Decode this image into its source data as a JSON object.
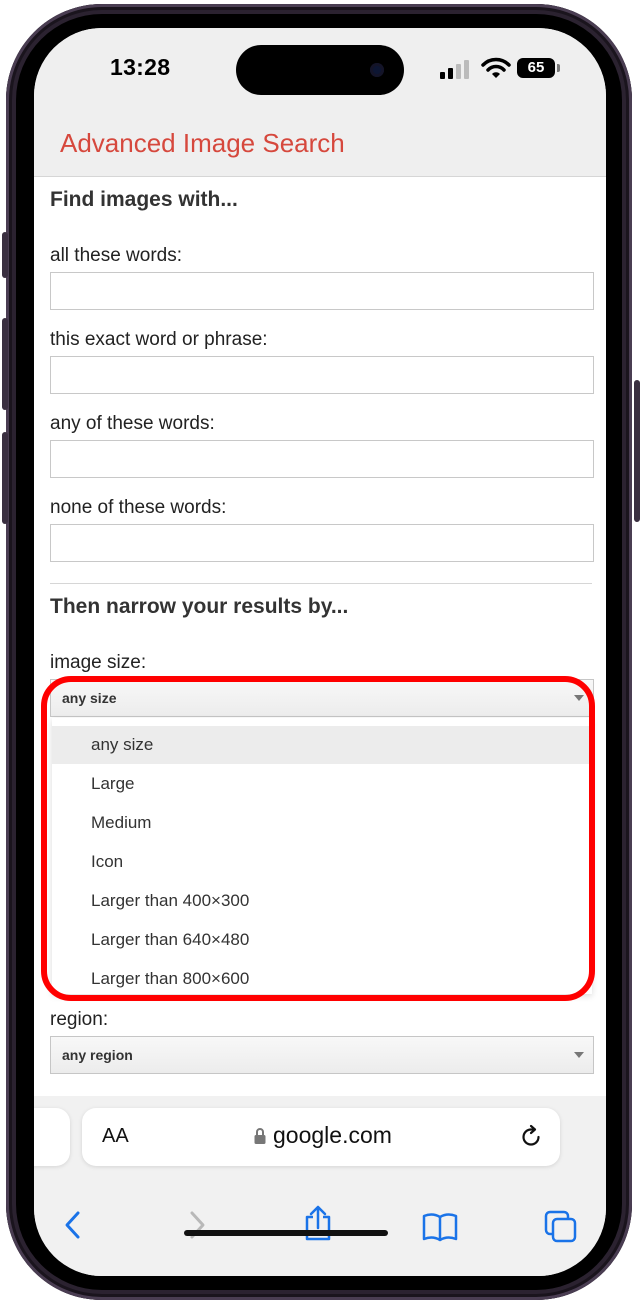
{
  "status_bar": {
    "time": "13:28",
    "battery": "65"
  },
  "page": {
    "title": "Advanced Image Search",
    "section_find": "Find images with...",
    "labels": {
      "all_words": "all these words:",
      "exact_phrase": "this exact word or phrase:",
      "any_words": "any of these words:",
      "none_words": "none of these words:"
    },
    "section_narrow": "Then narrow your results by...",
    "image_size": {
      "label": "image size:",
      "selected": "any size",
      "options": [
        "any size",
        "Large",
        "Medium",
        "Icon",
        "Larger than 400×300",
        "Larger than 640×480",
        "Larger than 800×600"
      ]
    },
    "region": {
      "label": "region:",
      "selected": "any region"
    }
  },
  "safari": {
    "aa_label": "AA",
    "url": "google.com"
  },
  "icons": {
    "back": "chevron-left-icon",
    "forward": "chevron-right-icon",
    "share": "share-icon",
    "bookmarks": "book-icon",
    "tabs": "tabs-icon",
    "reload": "reload-icon",
    "lock": "lock-icon"
  },
  "colors": {
    "title": "#d6483d",
    "highlight": "#ff0000",
    "toolbar_blue": "#1a73e8"
  }
}
